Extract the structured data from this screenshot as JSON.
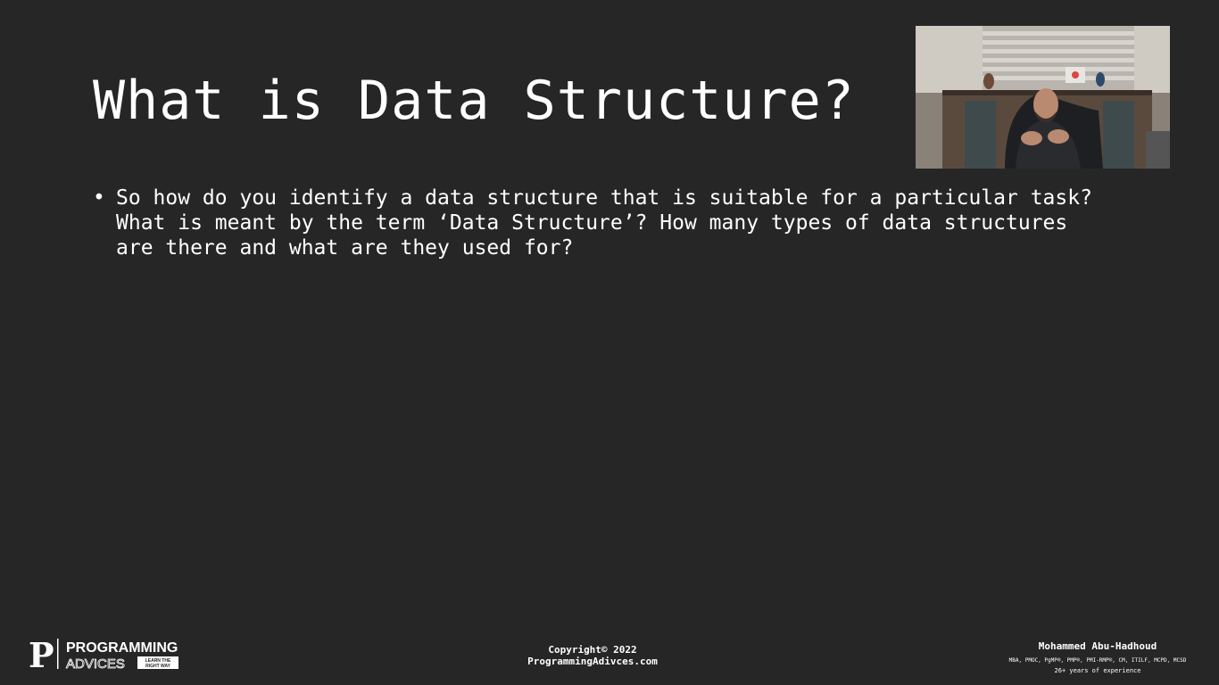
{
  "slide": {
    "title": "What is Data Structure?",
    "bullets": [
      {
        "marker": "•",
        "text": "So how do you identify a data structure that is suitable for a particular task? What is meant by the term ‘Data Structure’? How many types of data structures are there and what are they used for?"
      }
    ]
  },
  "footer": {
    "logo": {
      "letter": "P",
      "line1": "PROGRAMMING",
      "line2": "ADVICES",
      "tagline_1": "LEARN THE",
      "tagline_2": "RIGHT WAY"
    },
    "copyright_line1": "Copyright© 2022",
    "copyright_line2": "ProgrammingAdivces.com",
    "author_name": "Mohammed Abu-Hadhoud",
    "author_credentials": "MBA, PMOC, PgMP®, PMP®, PMI-RMP®, CM, ITILF, MCPD, MCSD",
    "author_experience": "26+ years of experience"
  },
  "colors": {
    "background": "#262626",
    "text": "#ffffff"
  }
}
